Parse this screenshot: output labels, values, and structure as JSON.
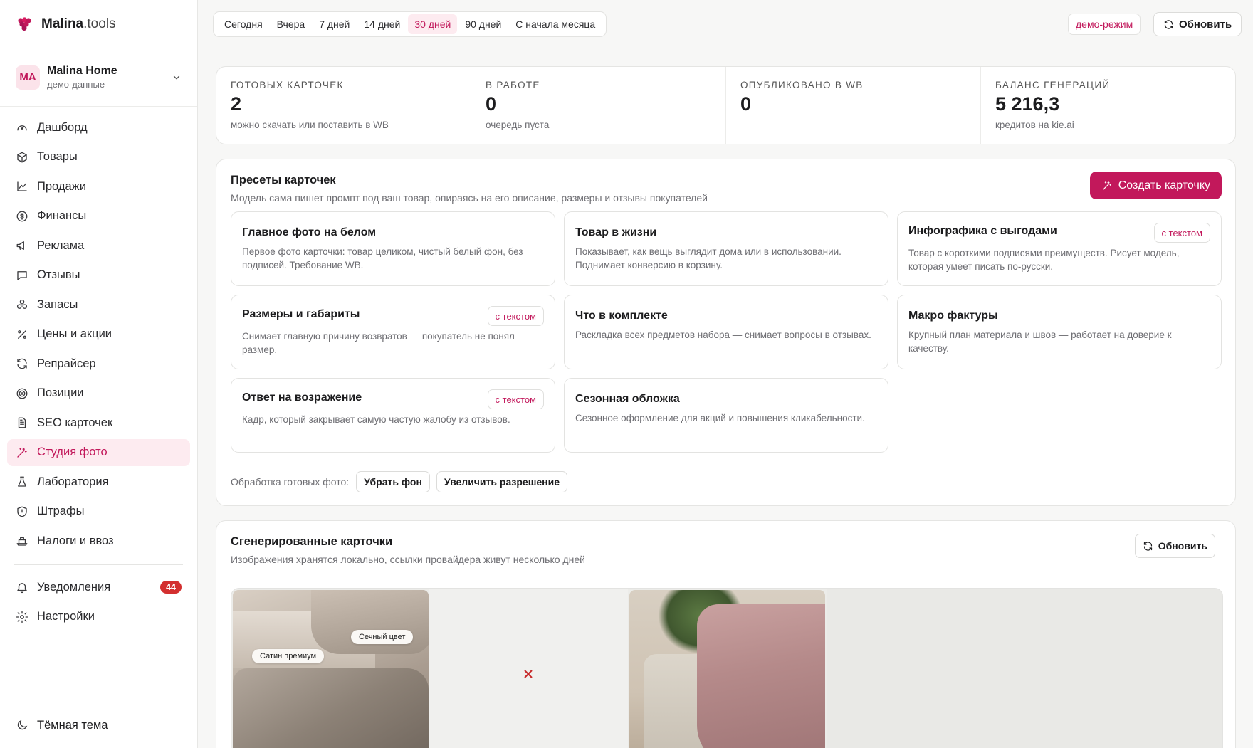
{
  "brand": {
    "name_bold": "Malina",
    "name_light": ".tools"
  },
  "store": {
    "initials": "MA",
    "name": "Malina Home",
    "subtitle": "демо-данные"
  },
  "nav": [
    {
      "label": "Дашборд",
      "icon": "gauge-icon"
    },
    {
      "label": "Товары",
      "icon": "box-icon"
    },
    {
      "label": "Продажи",
      "icon": "chart-line-icon"
    },
    {
      "label": "Финансы",
      "icon": "coin-icon"
    },
    {
      "label": "Реклама",
      "icon": "megaphone-icon"
    },
    {
      "label": "Отзывы",
      "icon": "message-icon"
    },
    {
      "label": "Запасы",
      "icon": "boxes-icon"
    },
    {
      "label": "Цены и акции",
      "icon": "percent-icon"
    },
    {
      "label": "Репрайсер",
      "icon": "refresh-icon"
    },
    {
      "label": "Позиции",
      "icon": "target-icon"
    },
    {
      "label": "SEO карточек",
      "icon": "document-icon"
    },
    {
      "label": "Студия фото",
      "icon": "wand-icon",
      "active": true
    },
    {
      "label": "Лаборатория",
      "icon": "flask-icon"
    },
    {
      "label": "Штрафы",
      "icon": "shield-icon"
    },
    {
      "label": "Налоги и ввоз",
      "icon": "ship-icon"
    }
  ],
  "nav_bottom": [
    {
      "label": "Уведомления",
      "icon": "bell-icon",
      "badge": "44"
    },
    {
      "label": "Настройки",
      "icon": "gear-icon"
    }
  ],
  "theme_toggle": "Тёмная тема",
  "periods": [
    {
      "label": "Сегодня"
    },
    {
      "label": "Вчера"
    },
    {
      "label": "7 дней"
    },
    {
      "label": "14 дней"
    },
    {
      "label": "30 дней",
      "active": true
    },
    {
      "label": "90 дней"
    },
    {
      "label": "С начала месяца"
    }
  ],
  "topbar": {
    "demo": "демо-режим",
    "refresh": "Обновить"
  },
  "stats": [
    {
      "label": "Готовых карточек",
      "value": "2",
      "sub": "можно скачать или поставить в WB"
    },
    {
      "label": "В работе",
      "value": "0",
      "sub": "очередь пуста"
    },
    {
      "label": "Опубликовано в WB",
      "value": "0",
      "sub": ""
    },
    {
      "label": "Баланс генераций",
      "value": "5 216,3",
      "sub": "кредитов на kie.ai"
    }
  ],
  "presets": {
    "title": "Пресеты карточек",
    "subtitle": "Модель сама пишет промпт под ваш товар, опираясь на его описание, размеры и отзывы покупателей",
    "create_label": "Создать карточку",
    "cards": [
      {
        "title": "Главное фото на белом",
        "desc": "Первое фото карточки: товар целиком, чистый белый фон, без подписей. Требование WB.",
        "tag": ""
      },
      {
        "title": "Товар в жизни",
        "desc": "Показывает, как вещь выглядит дома или в использовании. Поднимает конверсию в корзину.",
        "tag": ""
      },
      {
        "title": "Инфографика с выгодами",
        "desc": "Товар с короткими подписями преимуществ. Рисует модель, которая умеет писать по-русски.",
        "tag": "с текстом"
      },
      {
        "title": "Размеры и габариты",
        "desc": "Снимает главную причину возвратов — покупатель не понял размер.",
        "tag": "с текстом"
      },
      {
        "title": "Что в комплекте",
        "desc": "Раскладка всех предметов набора — снимает вопросы в отзывах.",
        "tag": ""
      },
      {
        "title": "Макро фактуры",
        "desc": "Крупный план материала и швов — работает на доверие к качеству.",
        "tag": ""
      },
      {
        "title": "Ответ на возражение",
        "desc": "Кадр, который закрывает самую частую жалобу из отзывов.",
        "tag": "с текстом"
      },
      {
        "title": "Сезонная обложка",
        "desc": "Сезонное оформление для акций и повышения кликабельности.",
        "tag": ""
      }
    ],
    "processing_label": "Обработка готовых фото:",
    "processing_buttons": [
      "Убрать фон",
      "Увеличить разрешение"
    ]
  },
  "generated": {
    "title": "Сгенерированные карточки",
    "subtitle": "Изображения хранятся локально, ссылки провайдера живут несколько дней",
    "refresh_label": "Обновить",
    "thumb1_labels": [
      "Сечный цвет",
      "Сатин премиум"
    ]
  },
  "colors": {
    "accent": "#c2185b",
    "accent_bg": "#fdebf0",
    "badge": "#d32f2f"
  }
}
